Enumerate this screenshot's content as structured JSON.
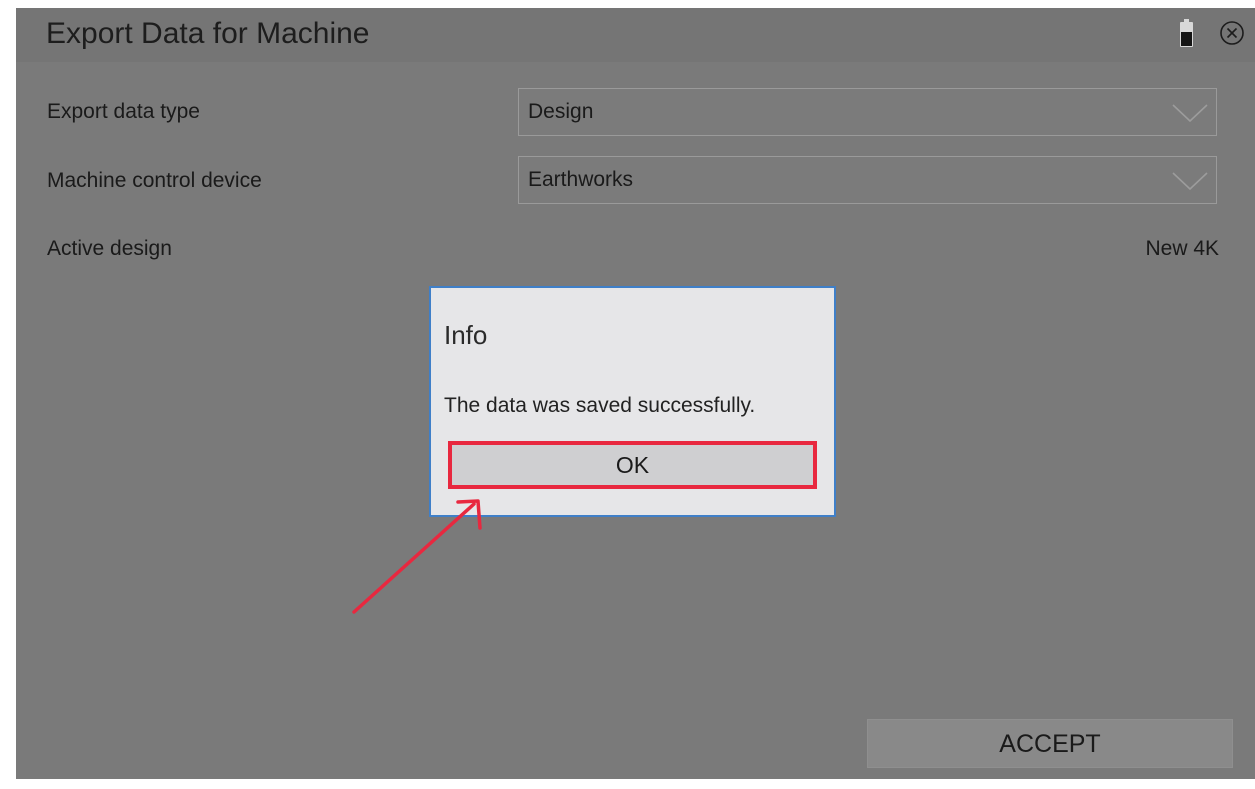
{
  "window": {
    "title": "Export Data for Machine",
    "icons": {
      "battery": "battery-icon",
      "close": "close-circle-icon"
    }
  },
  "form": {
    "export_data_type": {
      "label": "Export data type",
      "value": "Design"
    },
    "machine_control_device": {
      "label": "Machine control device",
      "value": "Earthworks"
    },
    "active_design": {
      "label": "Active design",
      "value": "New 4K"
    }
  },
  "footer": {
    "accept_label": "ACCEPT"
  },
  "dialog": {
    "title": "Info",
    "message": "The data was saved successfully.",
    "ok_label": "OK"
  },
  "colors": {
    "overlay_background": "#7a7a7a",
    "dialog_background": "#e6e6e8",
    "dialog_border": "#3f7fc8",
    "annotation_red": "#e8283f"
  }
}
